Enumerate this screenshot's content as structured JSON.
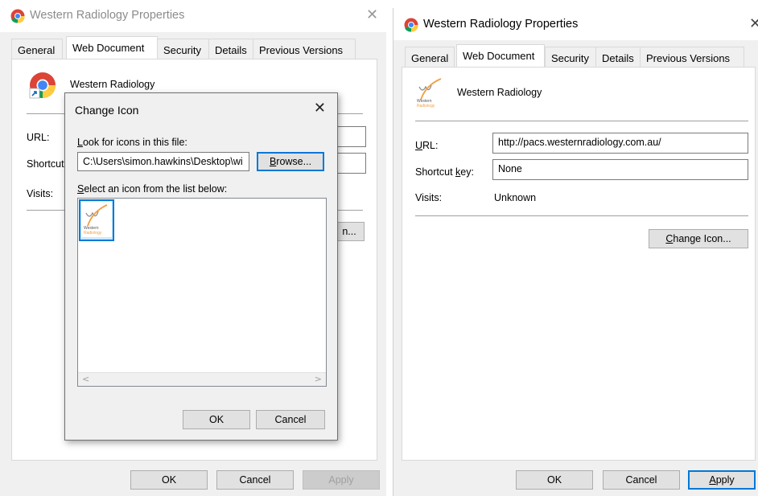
{
  "left_window": {
    "title": "Western Radiology Properties",
    "close_glyph": "✕",
    "tabs": [
      "General",
      "Web Document",
      "Security",
      "Details",
      "Previous Versions"
    ],
    "shortcut_name": "Western Radiology",
    "labels": {
      "url": "URL:",
      "shortcut": "Shortcut",
      "visits": "Visits:"
    },
    "change_icon_partial": "n...",
    "buttons": {
      "ok": "OK",
      "cancel": "Cancel",
      "apply": "Apply"
    }
  },
  "change_icon_dialog": {
    "title": "Change Icon",
    "close_glyph": "✕",
    "look_label": "Look for icons in this file:",
    "file_path": "C:\\Users\\simon.hawkins\\Desktop\\wi",
    "browse_label": "Browse...",
    "select_label": "Select an icon from the list below:",
    "scroll_left": "<",
    "scroll_right": ">",
    "ok_label": "OK",
    "cancel_label": "Cancel",
    "icon_text_1": "Western",
    "icon_text_2": "Radiology"
  },
  "right_window": {
    "title": "Western Radiology Properties",
    "close_glyph": "✕",
    "tabs": [
      "General",
      "Web Document",
      "Security",
      "Details",
      "Previous Versions"
    ],
    "shortcut_name": "Western Radiology",
    "url_label": "URL:",
    "url_value": "http://pacs.westernradiology.com.au/",
    "shortcut_key_label": "Shortcut key:",
    "shortcut_key_value": "None",
    "visits_label": "Visits:",
    "visits_value": "Unknown",
    "change_icon_label": "Change Icon...",
    "buttons": {
      "ok": "OK",
      "cancel": "Cancel",
      "apply": "Apply"
    }
  },
  "icons": {
    "app": "chrome-icon",
    "shortcut_logo": "western-radiology-logo-icon"
  },
  "colors": {
    "accent": "#0078d7",
    "dialog_bg": "#f0f0f0",
    "logo_orange": "#f0a040"
  }
}
